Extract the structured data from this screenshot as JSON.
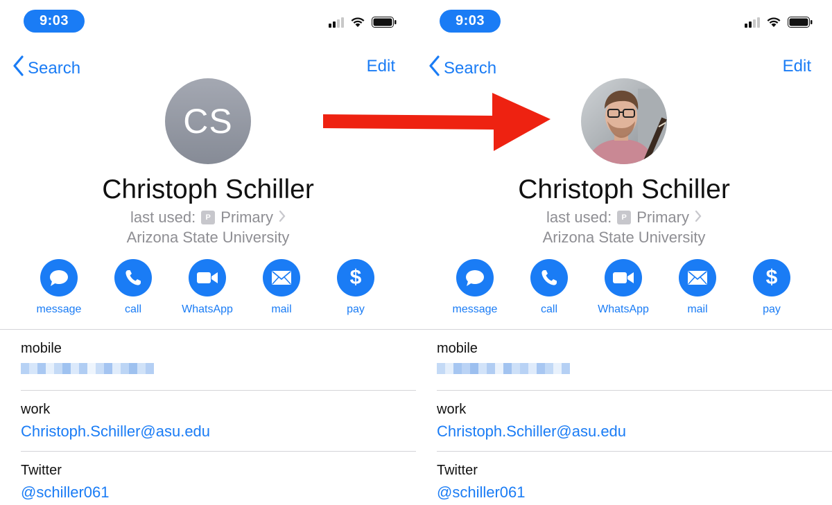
{
  "status_bar": {
    "time": "9:03"
  },
  "nav": {
    "back_label": "Search",
    "edit_label": "Edit"
  },
  "contact": {
    "initials": "CS",
    "name": "Christoph Schiller",
    "last_used_prefix": "last used:",
    "last_used_badge": "P",
    "last_used_value": "Primary",
    "organization": "Arizona State University"
  },
  "actions": [
    {
      "label": "message",
      "icon": "message-bubble-icon"
    },
    {
      "label": "call",
      "icon": "phone-icon"
    },
    {
      "label": "WhatsApp",
      "icon": "video-camera-icon"
    },
    {
      "label": "mail",
      "icon": "envelope-icon"
    },
    {
      "label": "pay",
      "icon": "dollar-icon"
    }
  ],
  "fields": {
    "mobile_label": "mobile",
    "work_label": "work",
    "work_value": "Christoph.Schiller@asu.edu",
    "twitter_label": "Twitter",
    "twitter_value": "@schiller061"
  },
  "colors": {
    "accent": "#1a7cf5",
    "arrow": "#ee2211",
    "secondary_text": "#8e8e93"
  },
  "panels": [
    {
      "avatar_style": "initials"
    },
    {
      "avatar_style": "photo"
    }
  ]
}
